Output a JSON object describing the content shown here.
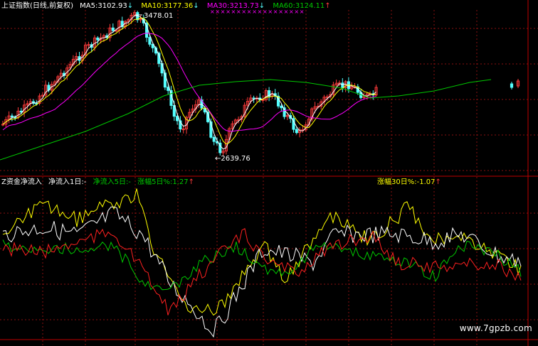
{
  "colors": {
    "background": "#000000",
    "grid_red": "#8a0f0f",
    "up_candle": "#ff3b3b",
    "down_candle": "#54ffff",
    "ma5": "#ffffff",
    "ma10": "#ffff00",
    "ma30": "#ff00ff",
    "ma60": "#00c800",
    "flow1": "#ffffff",
    "flow5": "#ffff00",
    "flow_green": "#00c800",
    "flow_red": "#ff2020"
  },
  "top_panel": {
    "title": "上证指数(日线,前复权)",
    "ma5_label": "MA5:3102.93",
    "ma10_label": "MA10:3177.36",
    "ma30_label": "MA30:3213.73",
    "ma60_label": "MA60:3124.11",
    "high_label": "3478.01",
    "low_label": "←2639.76",
    "marker_glyph": "×"
  },
  "bottom_panel": {
    "label_main": "Z资金净流入",
    "label_in1": "净流入1日:-",
    "label_in5": "净流入5日:-",
    "label_rise5": "涨幅5日%:1.27",
    "label_rise30": "涨幅30日%:-1.07"
  },
  "watermark": "www.7gpzb.com"
}
